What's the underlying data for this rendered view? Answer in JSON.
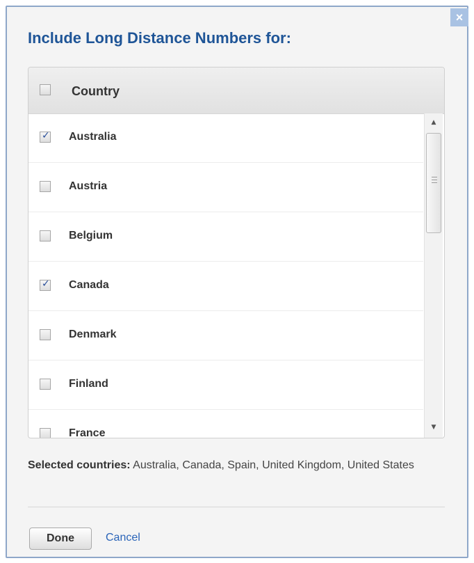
{
  "dialog": {
    "title": "Include Long Distance Numbers for:",
    "close_icon": "close-icon"
  },
  "grid": {
    "header": {
      "label": "Country",
      "checked": false
    },
    "rows": [
      {
        "label": "Australia",
        "checked": true
      },
      {
        "label": "Austria",
        "checked": false
      },
      {
        "label": "Belgium",
        "checked": false
      },
      {
        "label": "Canada",
        "checked": true
      },
      {
        "label": "Denmark",
        "checked": false
      },
      {
        "label": "Finland",
        "checked": false
      },
      {
        "label": "France",
        "checked": false
      }
    ]
  },
  "selection": {
    "label": "Selected countries:",
    "value": "Australia, Canada, Spain, United Kingdom, United States"
  },
  "footer": {
    "done_label": "Done",
    "cancel_label": "Cancel"
  },
  "colors": {
    "title": "#1f5597",
    "link": "#2a64b8",
    "dialog_border": "#8ea7c9",
    "close_bg": "#a9c2e3"
  }
}
